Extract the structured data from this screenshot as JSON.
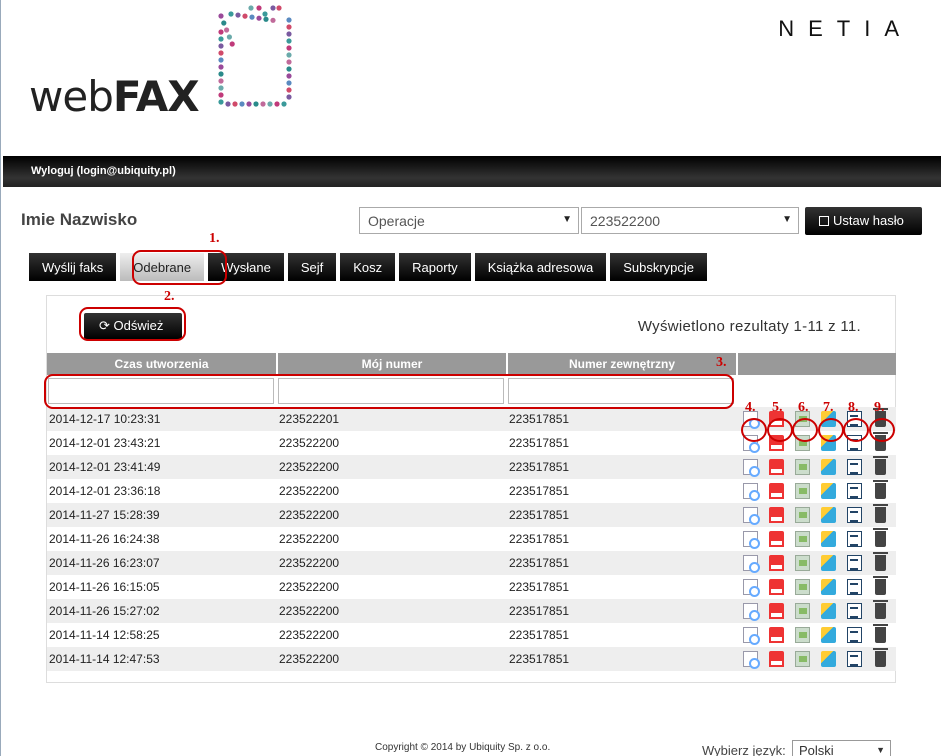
{
  "header": {
    "logo_light": "web",
    "logo_bold": "FAX",
    "brand": "NETIA"
  },
  "topbar": {
    "logout": "Wyloguj (login@ubiquity.pl)"
  },
  "user": {
    "name": "Imie Nazwisko",
    "operations_select": "Operacje",
    "number_select": "223522200",
    "password_button": "Ustaw hasło"
  },
  "tabs": [
    "Wyślij faks",
    "Odebrane",
    "Wysłane",
    "Sejf",
    "Kosz",
    "Raporty",
    "Książka adresowa",
    "Subskrypcje"
  ],
  "active_tab": "Odebrane",
  "panel": {
    "refresh_button": "Odśwież",
    "results_text": "Wyświetlono rezultaty 1-11 z 11."
  },
  "table": {
    "columns": [
      "Czas utworzenia",
      "Mój numer",
      "Numer zewnętrzny",
      ""
    ],
    "rows": [
      [
        "2014-12-17 10:23:31",
        "223522201",
        "223517851"
      ],
      [
        "2014-12-01 23:43:21",
        "223522200",
        "223517851"
      ],
      [
        "2014-12-01 23:41:49",
        "223522200",
        "223517851"
      ],
      [
        "2014-12-01 23:36:18",
        "223522200",
        "223517851"
      ],
      [
        "2014-11-27 15:28:39",
        "223522200",
        "223517851"
      ],
      [
        "2014-11-26 16:24:38",
        "223522200",
        "223517851"
      ],
      [
        "2014-11-26 16:23:07",
        "223522200",
        "223517851"
      ],
      [
        "2014-11-26 16:15:05",
        "223522200",
        "223517851"
      ],
      [
        "2014-11-26 15:27:02",
        "223522200",
        "223517851"
      ],
      [
        "2014-11-14 12:58:25",
        "223522200",
        "223517851"
      ],
      [
        "2014-11-14 12:47:53",
        "223522200",
        "223517851"
      ]
    ],
    "action_icons": [
      "preview-icon",
      "pdf-icon",
      "tif-icon",
      "email-icon",
      "document-icon",
      "trash-icon"
    ]
  },
  "annotations": [
    "1.",
    "2.",
    "3.",
    "4.",
    "5.",
    "6.",
    "7.",
    "8.",
    "9."
  ],
  "footer": {
    "copyright": "Copyright © 2014 by Ubiquity Sp. z o.o.",
    "language_label": "Wybierz język:",
    "language_value": "Polski"
  },
  "colors": {
    "annotation": "#cc0000",
    "dark_button": "#000000",
    "table_header": "#999999"
  }
}
